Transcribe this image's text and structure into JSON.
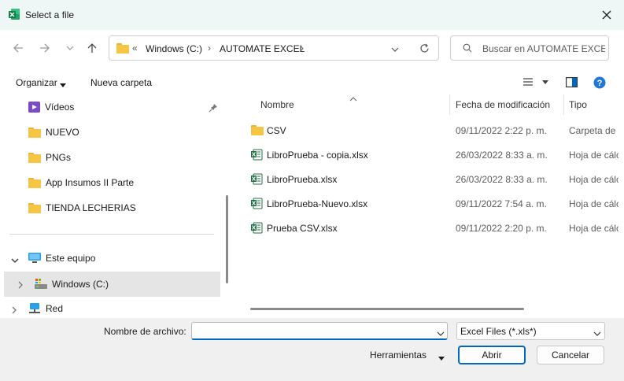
{
  "window": {
    "title": "Select a file"
  },
  "address": {
    "overflow": "«",
    "crumbs": [
      "Windows (C:)",
      "AUTOMATE EXCEL"
    ]
  },
  "search": {
    "placeholder": "Buscar en AUTOMATE EXCEL"
  },
  "toolbar": {
    "organize": "Organizar",
    "new_folder": "Nueva carpeta"
  },
  "nav": {
    "items": [
      {
        "label": "Vídeos",
        "icon": "video-folder-icon",
        "pinned": true
      },
      {
        "label": "NUEVO",
        "icon": "folder-icon"
      },
      {
        "label": "PNGs",
        "icon": "folder-icon"
      },
      {
        "label": "App Insumos II Parte",
        "icon": "folder-icon"
      },
      {
        "label": "TIENDA LECHERIAS",
        "icon": "folder-icon"
      }
    ],
    "this_pc": "Este equipo",
    "drive": "Windows (C:)",
    "network": "Red"
  },
  "columns": {
    "name": "Nombre",
    "modified": "Fecha de modificación",
    "type": "Tipo"
  },
  "files": [
    {
      "name": "CSV",
      "modified": "09/11/2022 2:22 p. m.",
      "type": "Carpeta de a",
      "icon": "folder-icon"
    },
    {
      "name": "LibroPrueba - copia.xlsx",
      "modified": "26/03/2022 8:33 a. m.",
      "type": "Hoja de cálc",
      "icon": "excel-file-icon"
    },
    {
      "name": "LibroPrueba.xlsx",
      "modified": "26/03/2022 8:33 a. m.",
      "type": "Hoja de cálc",
      "icon": "excel-file-icon"
    },
    {
      "name": "LibroPrueba-Nuevo.xlsx",
      "modified": "09/11/2022 7:54 a. m.",
      "type": "Hoja de cálc",
      "icon": "excel-file-icon"
    },
    {
      "name": "Prueba CSV.xlsx",
      "modified": "09/11/2022 2:20 p. m.",
      "type": "Hoja de cálc",
      "icon": "excel-file-icon"
    }
  ],
  "bottom": {
    "filename_label": "Nombre de archivo:",
    "filename_value": "",
    "filter": "Excel Files (*.xls*)",
    "tools": "Herramientas",
    "open": "Abrir",
    "cancel": "Cancelar"
  },
  "colors": {
    "accent": "#0067c0",
    "excel_green": "#1d6f42",
    "folder": "#f5c543",
    "selection": "#e5e5e5"
  }
}
